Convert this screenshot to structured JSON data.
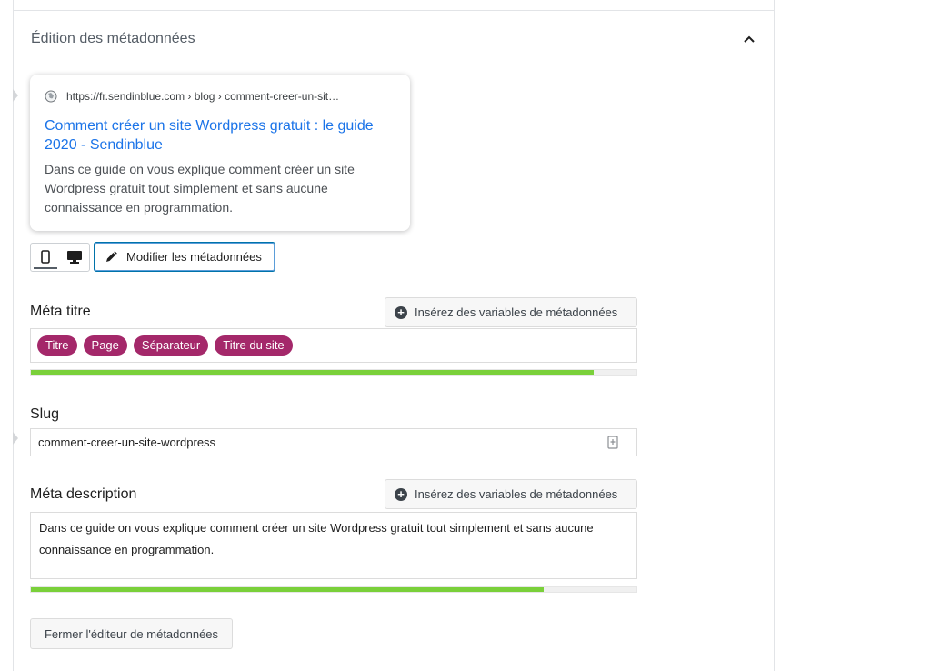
{
  "section": {
    "title": "Édition des métadonnées"
  },
  "preview": {
    "url": "https://fr.sendinblue.com › blog › comment-creer-un-sit…",
    "title": "Comment créer un site Wordpress gratuit : le guide 2020 - Sendinblue",
    "description": "Dans ce guide on vous explique comment créer un site Wordpress gratuit tout simplement et sans aucune connaissance en programmation."
  },
  "toolbar": {
    "edit_label": "Modifier les métadonnées",
    "active_device": "mobile"
  },
  "meta_title": {
    "label": "Méta titre",
    "vars_button": "Insérez des variables de métadonnées",
    "tags": [
      "Titre",
      "Page",
      "Séparateur",
      "Titre du site"
    ],
    "progress": 0.93
  },
  "slug": {
    "label": "Slug",
    "value": "comment-creer-un-site-wordpress"
  },
  "meta_description": {
    "label": "Méta description",
    "vars_button": "Insérez des variables de métadonnées",
    "value": "Dans ce guide on vous explique comment créer un site Wordpress gratuit tout simplement et sans aucune connaissance en programmation.",
    "progress": 0.847
  },
  "close_button": "Fermer l'éditeur de métadonnées",
  "colors": {
    "tag": "#a4286a",
    "progress": "#7ad03a",
    "link": "#1a73e8"
  }
}
